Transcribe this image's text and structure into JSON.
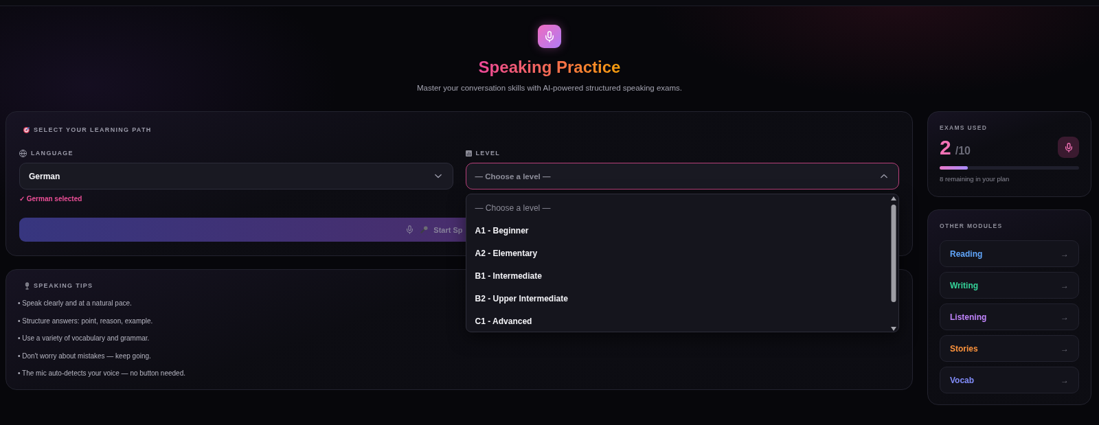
{
  "header": {
    "title": "Speaking Practice",
    "subtitle": "Master your conversation skills with AI-powered structured speaking exams."
  },
  "path_card": {
    "title": "SELECT YOUR LEARNING PATH",
    "language": {
      "label": "LANGUAGE",
      "value": "German",
      "expanded": false,
      "confirmation": "✓ German selected"
    },
    "level": {
      "label": "LEVEL",
      "placeholder": "— Choose a level —",
      "expanded": true,
      "options": [
        {
          "label": "— Choose a level —",
          "disabled": true,
          "selected": false
        },
        {
          "label": "A1 - Beginner",
          "disabled": false,
          "selected": false
        },
        {
          "label": "A2 - Elementary",
          "disabled": false,
          "selected": false
        },
        {
          "label": "B1 - Intermediate",
          "disabled": false,
          "selected": false
        },
        {
          "label": "B2 - Upper Intermediate",
          "disabled": false,
          "selected": false
        },
        {
          "label": "C1 - Advanced",
          "disabled": false,
          "selected": false
        }
      ]
    },
    "start_button": {
      "label": "Start Sp",
      "disabled": true
    }
  },
  "tips": {
    "title": "SPEAKING TIPS",
    "items": [
      "• Speak clearly and at a natural pace.",
      "• Structure answers: point, reason, example.",
      "• Use a variety of vocabulary and grammar.",
      "• Don't worry about mistakes — keep going.",
      "• The mic auto-detects your voice — no button needed."
    ]
  },
  "exams": {
    "title": "EXAMS USED",
    "used": "2",
    "total": "/10",
    "level": 0.2,
    "remaining": "8 remaining in your plan"
  },
  "modules": {
    "title": "OTHER MODULES",
    "items": [
      {
        "label": "Reading",
        "color": "#60a5fa",
        "arrow": "→"
      },
      {
        "label": "Writing",
        "color": "#34d399",
        "arrow": "→"
      },
      {
        "label": "Listening",
        "color": "#c084fc",
        "arrow": "→"
      },
      {
        "label": "Stories",
        "color": "#fb923c",
        "arrow": "→"
      },
      {
        "label": "Vocab",
        "color": "#818cf8",
        "arrow": "→"
      }
    ]
  }
}
